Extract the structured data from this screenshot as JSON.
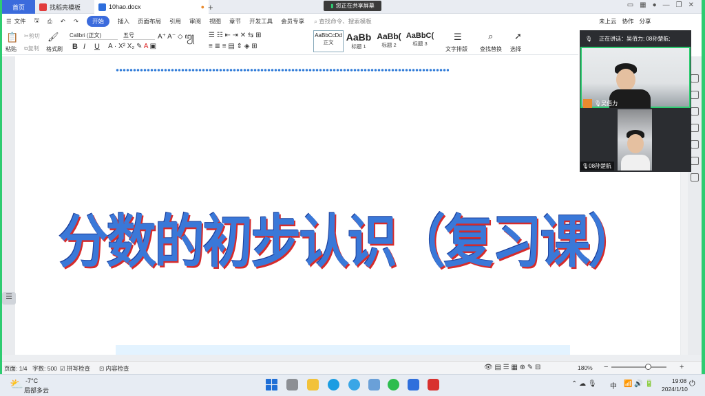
{
  "tabs": {
    "home": "首页",
    "templates": "找稻壳模板",
    "doc": "10hao.docx"
  },
  "share_banner": "您正在共享屏幕",
  "menu": {
    "file": "文件",
    "items": [
      "开始",
      "插入",
      "页面布局",
      "引用",
      "审阅",
      "视图",
      "章节",
      "开发工具",
      "会员专享"
    ],
    "search_placeholder": "查找命令、搜索模板",
    "right": [
      "未上云",
      "协作",
      "分享"
    ]
  },
  "ribbon": {
    "paste": "粘贴",
    "cut": "剪切",
    "copy": "复制",
    "format_painter": "格式刷",
    "font": "Calibri (正文)",
    "size": "五号",
    "styles": [
      {
        "preview": "AaBbCcDd",
        "label": "正文"
      },
      {
        "preview": "AaBb",
        "label": "标题 1"
      },
      {
        "preview": "AaBb(",
        "label": "标题 2"
      },
      {
        "preview": "AaBbC(",
        "label": "标题 3"
      }
    ],
    "text_layout": "文字排版",
    "find_replace": "查找替换",
    "select": "选择"
  },
  "document": {
    "title": "分数的初步认识（复习课）"
  },
  "meeting": {
    "speaking": "正在讲话：吴佰力; 08孙楚航;",
    "participant1": "吴佰力",
    "participant2": "08孙楚航"
  },
  "status": {
    "page": "页面: 1/4",
    "words": "字数: 500",
    "spell": "拼写检查",
    "content_check": "内容检查",
    "zoom": "180%"
  },
  "taskbar": {
    "temp": "-7°C",
    "weather": "局部多云",
    "ime": "中",
    "time": "19:08",
    "date": "2024/1/10"
  }
}
